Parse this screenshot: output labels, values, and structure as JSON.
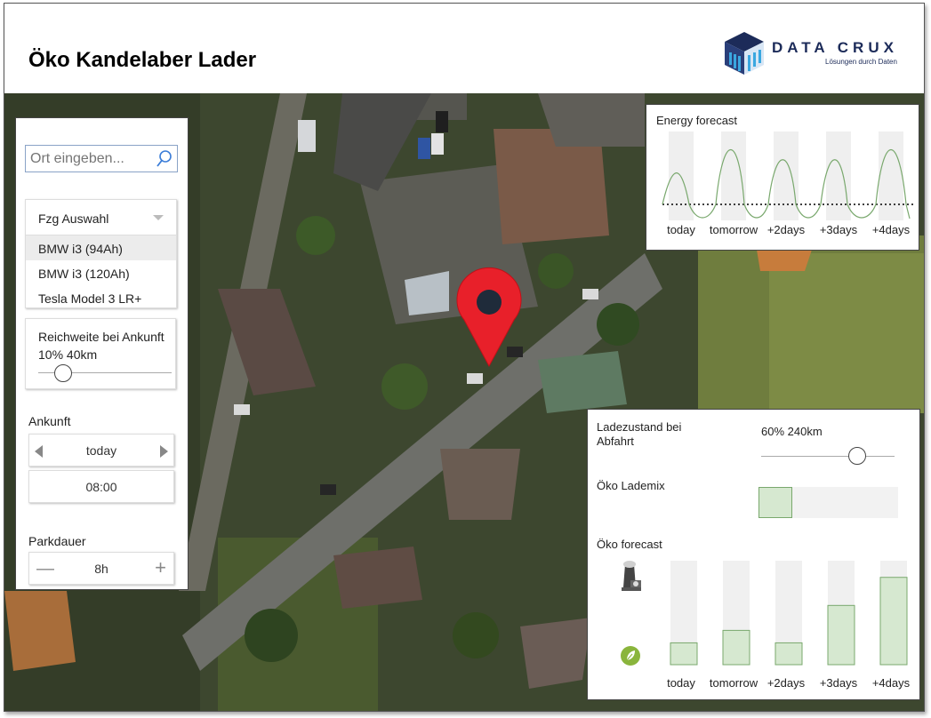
{
  "app": {
    "title": "Öko Kandelaber Lader",
    "logo_word": "DATA CRUX",
    "logo_sub": "Lösungen durch Daten"
  },
  "search": {
    "placeholder": "Ort eingeben..."
  },
  "vehicle": {
    "label": "Fzg Auswahl",
    "options": [
      "BMW i3 (94Ah)",
      "BMW i3 (120Ah)",
      "Tesla Model 3 LR+"
    ],
    "selected_index": 0
  },
  "range_arrival": {
    "label": "Reichweite bei Ankunft",
    "value_text": "10% 40km",
    "fraction": 0.1
  },
  "arrival": {
    "label": "Ankunft",
    "day": "today",
    "time": "08:00"
  },
  "parking": {
    "label": "Parkdauer",
    "value": "8h"
  },
  "energy_forecast": {
    "title": "Energy forecast",
    "days": [
      "today",
      "tomorrow",
      "+2days",
      "+3days",
      "+4days"
    ]
  },
  "departure": {
    "label": "Ladezustand bei Abfahrt",
    "value_text": "60% 240km",
    "fraction": 0.72
  },
  "eco_mix": {
    "label": "Öko Lademix",
    "fraction": 0.24
  },
  "eco_forecast": {
    "label": "Öko forecast",
    "days": [
      "today",
      "tomorrow",
      "+2days",
      "+3days",
      "+4days"
    ],
    "levels": [
      0.21,
      0.33,
      0.21,
      0.57,
      0.84
    ]
  },
  "colors": {
    "accent_green": "#79a86d",
    "fill_green": "#d6e8d0",
    "pin_red": "#e8202a",
    "logo_navy": "#1c2b59"
  }
}
